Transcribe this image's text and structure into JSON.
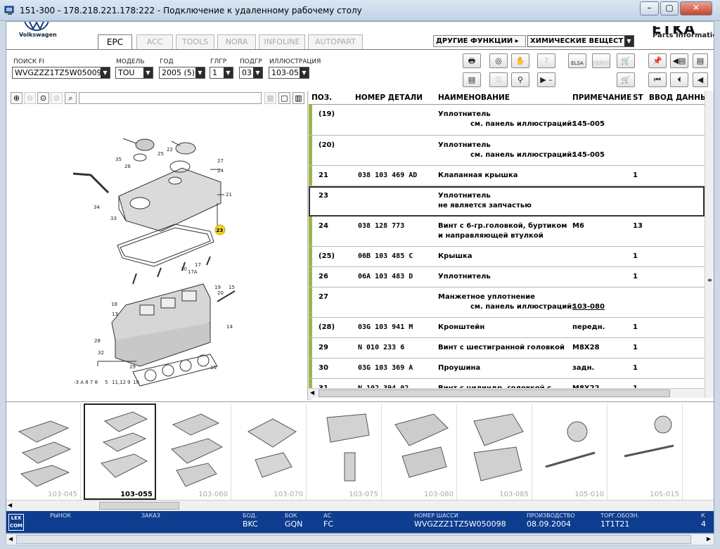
{
  "window": {
    "title": "151-300 - 178.218.221.178:222 - Подключение к удаленному рабочему столу",
    "min": "–",
    "max": "▢",
    "close": "✕"
  },
  "brand": {
    "vw_name": "Volkswagen",
    "etka_title": "ETKA",
    "etka_sub": "Parts Information"
  },
  "tabs": [
    "EPC",
    "ACC",
    "TOOLS",
    "NORA",
    "INFOLINE",
    "AUTOPART"
  ],
  "menus": {
    "other_functions": "ДРУГИЕ ФУНКЦИИ ▸",
    "chemicals": "ХИМИЧЕСКИЕ ВЕЩЕСТ"
  },
  "filters": {
    "fi_label": "ПОИСК FI",
    "fi_value": "WVGZZZ1TZ5W05009",
    "model_label": "МОДЕЛЬ",
    "model_value": "TOU",
    "year_label": "ГОД",
    "year_value": "2005 (5)",
    "hg_label": "ГЛГР",
    "hg_value": "1",
    "ug_label": "ПОДГР",
    "ug_value": "03",
    "illus_label": "ИЛЛЮСТРАЦИЯ",
    "illus_value": "103-055"
  },
  "toolbar_icons": {
    "row1": [
      "printer-icon",
      "cd-icon",
      "hand-money-icon",
      "help-icon",
      "elsa-icon",
      "depot-icon",
      "cart-icon"
    ],
    "row2": [
      "list-icon",
      "key-icon",
      "bicycle-icon",
      "play-minus-icon",
      "cart-check-icon"
    ],
    "elsa": "ELSA",
    "depot": "DEPOT"
  },
  "table": {
    "headers": [
      "ПОЗ.",
      "НОМЕР ДЕТАЛИ",
      "НАИМЕНОВАНИЕ",
      "ПРИМЕЧАНИЕ",
      "ST",
      "ВВОД ДАННЫХ"
    ],
    "rows": [
      {
        "pos": "(19)",
        "part": "",
        "name": "Уплотнитель",
        "name2": "см. панель иллюстраций:",
        "note": "",
        "note2": "145-005",
        "st": "",
        "sel": false,
        "link": false
      },
      {
        "pos": "(20)",
        "part": "",
        "name": "Уплотнитель",
        "name2": "см. панель иллюстраций:",
        "note": "",
        "note2": "145-005",
        "st": "",
        "sel": false,
        "link": false
      },
      {
        "pos": "21",
        "part": "038 103 469 AD",
        "name": "Клапанная крышка",
        "name2": "",
        "note": "",
        "note2": "",
        "st": "1",
        "sel": false,
        "link": false
      },
      {
        "pos": "23",
        "part": "",
        "name": "Уплотнитель",
        "name2": "не является запчастью",
        "note": "",
        "note2": "",
        "st": "",
        "sel": true,
        "link": false
      },
      {
        "pos": "24",
        "part": "038 128 773",
        "name": "Винт с 6-гр.головкой, буртиком",
        "name2": "и направляющей втулкой",
        "note": "M6",
        "note2": "",
        "st": "13",
        "sel": false,
        "link": false
      },
      {
        "pos": "(25)",
        "part": "06B 103 485 C",
        "name": "Крышка",
        "name2": "",
        "note": "",
        "note2": "",
        "st": "1",
        "sel": false,
        "link": false
      },
      {
        "pos": "26",
        "part": "06A 103 483 D",
        "name": "Уплотнитель",
        "name2": "",
        "note": "",
        "note2": "",
        "st": "1",
        "sel": false,
        "link": false
      },
      {
        "pos": "27",
        "part": "",
        "name": "Манжетное уплотнение",
        "name2": "см. панель иллюстраций:",
        "note": "",
        "note2": "103-080",
        "st": "",
        "sel": false,
        "link": true
      },
      {
        "pos": "(28)",
        "part": "03G 103 941 M",
        "name": "Кронштейн",
        "name2": "",
        "note": "передн.",
        "note2": "",
        "st": "1",
        "sel": false,
        "link": false
      },
      {
        "pos": "29",
        "part": "N    010 233 6",
        "name": "Винт с шестигранной головкой",
        "name2": "",
        "note": "M8X28",
        "note2": "",
        "st": "1",
        "sel": false,
        "link": false
      },
      {
        "pos": "30",
        "part": "03G 103 369 A",
        "name": "Проушина",
        "name2": "",
        "note": "задн.",
        "note2": "",
        "st": "1",
        "sel": false,
        "link": false
      },
      {
        "pos": "31",
        "part": "N    102 394 02",
        "name": "Винт с цилиндр. головкой с",
        "name2": "",
        "note": "M8X22",
        "note2": "",
        "st": "1",
        "sel": false,
        "link": false
      }
    ]
  },
  "illustration": {
    "labels": [
      "35",
      "26",
      "25",
      "22",
      "27",
      "24",
      "21",
      "23",
      "34",
      "33",
      "30",
      "17A",
      "17",
      "19",
      "20",
      "15",
      "18",
      "13",
      "14",
      "28",
      "32",
      "4",
      "5",
      "11",
      "12",
      "9",
      "10",
      "29",
      "3",
      "16",
      "8",
      "7",
      "6"
    ],
    "highlight": "23",
    "bottom_left": "-3 A 8 7 8"
  },
  "thumbnails": [
    "103-045",
    "103-055",
    "103-060",
    "103-070",
    "103-075",
    "103-080",
    "103-085",
    "105-010",
    "105-015"
  ],
  "status": {
    "lexcom": "LEX COM",
    "market_label": "РЫНОК",
    "market_value": "",
    "order_label": "ЗАКАЗ",
    "order_value": "",
    "bod_label": "БОД.",
    "bod_value": "BKC",
    "bok_label": "БОК",
    "bok_value": "GQN",
    "ac_label": "АС",
    "ac_value": "FC",
    "chassis_label": "НОМЕР ШАССИ",
    "chassis_value": "WVGZZZ1TZ5W050098",
    "prod_label": "ПРОИЗВОДСТВО",
    "prod_value": "08.09.2004",
    "trade_label": "ТОРГ.ОБОЗН.",
    "trade_value": "1T1T21",
    "extra_label": "К",
    "extra_value": "4"
  }
}
